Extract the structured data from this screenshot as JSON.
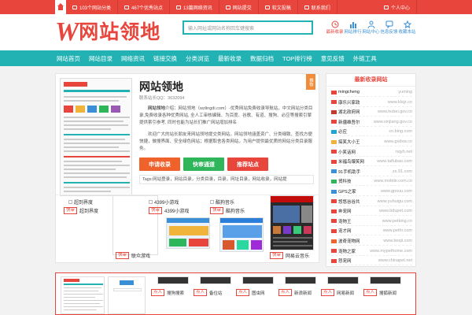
{
  "topbar": {
    "items": [
      "103个网站分类",
      "467个优秀站点",
      "13篇网络资讯",
      "网站提交",
      "软文投稿",
      "联系我们",
      "个人中心"
    ]
  },
  "header": {
    "logo_w": "W",
    "logo_text": "网站领地",
    "search_placeholder": "输入网址或网站名称回车键搜索",
    "nav_icons": [
      {
        "label": "最新收录",
        "icon": "new-icon"
      },
      {
        "label": "网站排行",
        "icon": "rank-icon"
      },
      {
        "label": "网站中心",
        "icon": "center-icon"
      },
      {
        "label": "信息反馈",
        "icon": "feedback-icon"
      },
      {
        "label": "收藏本站",
        "icon": "star-icon"
      }
    ]
  },
  "nav": {
    "items": [
      "网站首页",
      "网站目录",
      "网络资讯",
      "链接交换",
      "分类浏览",
      "最新收录",
      "数据归档",
      "TOP排行榜",
      "意见反馈",
      "外链工具"
    ]
  },
  "site": {
    "title": "网站领地",
    "meta": "联系站长QQ：3632094",
    "badge": "推荐",
    "desc1_label": "网站领地",
    "desc1": "介绍：网站领地（wzlingdi.com）-优秀网站免费收录导航站，中文网站分类目录,免费收录各种优秀网站, 全人工审核编辑、为百度、谷歌、有道、搜狗、必应等搜索引擎提供索引参考, 同时也能为站长们推广网站增加排名",
    "desc2": "欢迎广大的站长朋友来网站领地提交类网站，网站领地涵盖资广、分类细致、查找方便快捷，做搜界面、安全绿色网站；根据取舍各类网站，为用户提供最优质的网站分类目录服务。",
    "buttons": [
      "申请收录",
      "快审通道",
      "推荐站点"
    ],
    "button_colors": [
      "#f0622b",
      "#2fb55a",
      "#e8453c"
    ],
    "tags": "Tags:网站登录，网站目录，分类目录，目录，网址目录，网站收录，网站提"
  },
  "thumbs": [
    {
      "alt": "超到界度",
      "tag": "快审",
      "name": "超到界度"
    },
    {
      "alt": "",
      "tag": "快审",
      "name": "联众游戏"
    },
    {
      "alt": "4399小游戏",
      "tag": "快审",
      "name": "4399小游戏"
    },
    {
      "alt": "酷狗音乐",
      "tag": "快审",
      "name": "酷狗音乐"
    },
    {
      "alt": "",
      "tag": "快审",
      "name": "网易云音乐"
    }
  ],
  "sidebar": {
    "title": "最新收录网站",
    "items": [
      {
        "name": "mingcheng",
        "domain": "yuming",
        "color": "#e8453c"
      },
      {
        "name": "康乐兴家政",
        "domain": "www.klxjz.cn",
        "color": "#e8453c"
      },
      {
        "name": "湖北政府网",
        "domain": "www.hubei.gov.cn",
        "color": "#c0392b"
      },
      {
        "name": "新疆维吾尔",
        "domain": "www.xinjiang.gov.cn",
        "color": "#e8453c"
      },
      {
        "name": "必应",
        "domain": "cn.bing.com",
        "color": "#22a3d6"
      },
      {
        "name": "搞笑大小王",
        "domain": "www.gxdxw.cn",
        "color": "#f0b43a"
      },
      {
        "name": "小笑话网",
        "domain": "nqyh.net",
        "color": "#e8453c"
      },
      {
        "name": "米福鸟爆笑网",
        "domain": "www.taifubao.com",
        "color": "#e8453c"
      },
      {
        "name": "91手机助手",
        "domain": "zs.91.com",
        "color": "#3a8fd6"
      },
      {
        "name": "贸科技",
        "domain": "www.mobile.com.cn",
        "color": "#2fb55a"
      },
      {
        "name": "GPS之家",
        "domain": "www.gpsuu.com",
        "color": "#3a8fd6"
      },
      {
        "name": "悠悠谷谷共",
        "domain": "www.yuhuigu.com",
        "color": "#e8453c"
      },
      {
        "name": "奔宠网",
        "domain": "www.bdupet.com",
        "color": "#e8453c"
      },
      {
        "name": "宠物王",
        "domain": "www.petking.cn",
        "color": "#e8453c"
      },
      {
        "name": "宠才网",
        "domain": "www.pethr.com",
        "color": "#e8453c"
      },
      {
        "name": "波奇宠物网",
        "domain": "www.boqii.com",
        "color": "#f0622b"
      },
      {
        "name": "宠物之家",
        "domain": "www.mypethome.com",
        "color": "#e8453c"
      },
      {
        "name": "怒宠网",
        "domain": "www.chinapet.net",
        "color": "#e8453c"
      }
    ]
  },
  "bottom": {
    "items": [
      {
        "tag": "点入",
        "name": "搜狗搜索"
      },
      {
        "tag": "点入",
        "name": "备位站"
      },
      {
        "tag": "点入",
        "name": "图虫网"
      },
      {
        "tag": "点入",
        "name": "新浪新闻"
      },
      {
        "tag": "点入",
        "name": "网易新闻"
      },
      {
        "tag": "点入",
        "name": "搜狐新闻"
      }
    ]
  }
}
